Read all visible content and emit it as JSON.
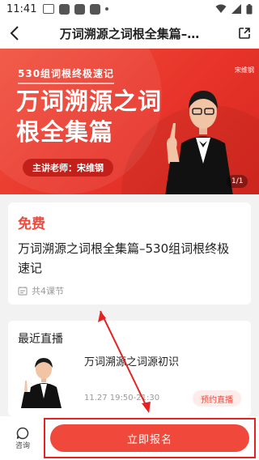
{
  "status_bar": {
    "time": "11:41"
  },
  "nav": {
    "title": "万词溯源之词根全集篇–…"
  },
  "banner": {
    "subtitle": "530组词根终极速记",
    "title": "万词溯源之词根全集篇",
    "teacher": "主讲老师：宋维钢",
    "teacher_tag": "宋维钢",
    "counter": "1/1"
  },
  "course": {
    "price": "免费",
    "title": "万词溯源之词根全集篇–530组词根终极速记",
    "lessons": "共4课节"
  },
  "live": {
    "header": "最近直播",
    "item": {
      "name": "万词溯源之词源初识",
      "time": "11.27 19:50-21:30",
      "button": "预约直播"
    }
  },
  "bottom": {
    "consult_label": "咨询",
    "signup_label": "立即报名"
  },
  "colors": {
    "accent": "#f0483a",
    "annotation": "#e52222"
  }
}
